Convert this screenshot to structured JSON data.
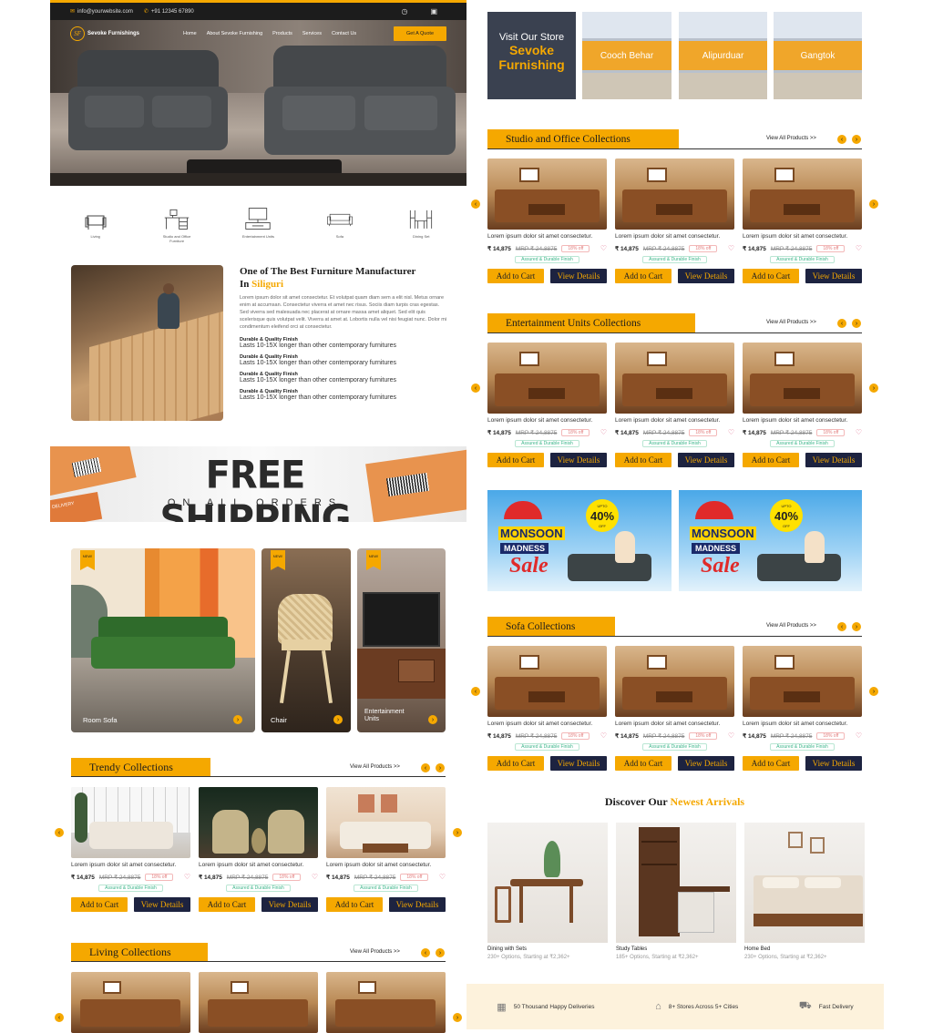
{
  "header": {
    "email": "info@yourwebsite.com",
    "phone": "+91 12345 67890",
    "brand": "Sevoke Furnishings",
    "nav": [
      "Home",
      "About Sevoke Furnishing",
      "Products",
      "Services",
      "Contact Us"
    ],
    "cta": "Get A Quote"
  },
  "categories": [
    "Living",
    "Studio and Office Furniture",
    "Entertainment Units",
    "Sofa",
    "Dining Set"
  ],
  "about": {
    "title_1": "One of The Best Furniture Manufacturer",
    "title_2_prefix": "In",
    "title_2_city": "Siliguri",
    "body": "Lorem ipsum dolor sit amet consectetur. Et volutpat quam diam sem a elit nisl. Metus ornare enim at accumsan. Consectetur viverra et amet nec risus. Sociis diam turpis cras egestas. Sed viverra sed malesuada nec placerat at ornare massa amet aliquet. Sed elit quis scelerisque quis volutpat velit. Viverra at amet at. Lobortis nulla vel nisi feugiat nunc. Dolor mi condimentum eleifend orci at consectetur.",
    "features": [
      {
        "title": "Durable & Quality Finish",
        "text": "Lasts 10-15X longer than other contemporary furnitures"
      },
      {
        "title": "Durable & Quality Finish",
        "text": "Lasts 10-15X longer than other contemporary furnitures"
      },
      {
        "title": "Durable & Quality Finish",
        "text": "Lasts 10-15X longer than other contemporary furnitures"
      },
      {
        "title": "Durable & Quality Finish",
        "text": "Lasts 10-15X longer than other contemporary furnitures"
      }
    ]
  },
  "shipping": {
    "title": "FREE SHIPPING",
    "subtitle": "ON ALL ORDERS",
    "tag": "DELIVERY"
  },
  "feature_tiles": [
    {
      "badge": "NEW!",
      "label": "Room Sofa"
    },
    {
      "badge": "NEW!",
      "label": "Chair"
    },
    {
      "badge": "NEW!",
      "label": "Entertainment Units"
    }
  ],
  "product": {
    "name": "Lorem ipsum dolor sit amet consectetur.",
    "price": "₹ 14,875",
    "mrp": "MRP ₹ 24,8875",
    "off": "18% off",
    "assured": "Assured & Durable Finish",
    "add_to_cart": "Add to Cart",
    "view_details": "View Details"
  },
  "sections": {
    "trendy": "Trendy Collections",
    "living": "Living Collections",
    "studio": "Studio and Office Collections",
    "entertainment": "Entertainment Units Collections",
    "sofa": "Sofa Collections",
    "view_all": "View All Products >>"
  },
  "stores": {
    "visit_1": "Visit Our Store",
    "visit_2": "Sevoke",
    "visit_3": "Furnishing",
    "locations": [
      "Cooch Behar",
      "Alipurduar",
      "Gangtok"
    ]
  },
  "promo": {
    "line1": "MONSOON",
    "line2": "MADNESS",
    "line3": "Sale",
    "upto": "UPTO",
    "pct": "40%",
    "off": "OFF"
  },
  "arrivals": {
    "title_1": "Discover Our",
    "title_2": "Newest Arrivals",
    "items": [
      {
        "name": "Dining with Sets",
        "meta": "230+ Options, Starting at ₹2,362+"
      },
      {
        "name": "Study Tables",
        "meta": "185+ Options, Starting at ₹2,362+"
      },
      {
        "name": "Home Bed",
        "meta": "230+ Options, Starting at ₹2,362+"
      }
    ]
  },
  "footer_strip": [
    "50 Thousand Happy Deliveries",
    "8+ Stores Across 5+ Cities",
    "Fast Delivery"
  ],
  "colors": {
    "accent": "#f5a800",
    "navy": "#1d2340"
  }
}
